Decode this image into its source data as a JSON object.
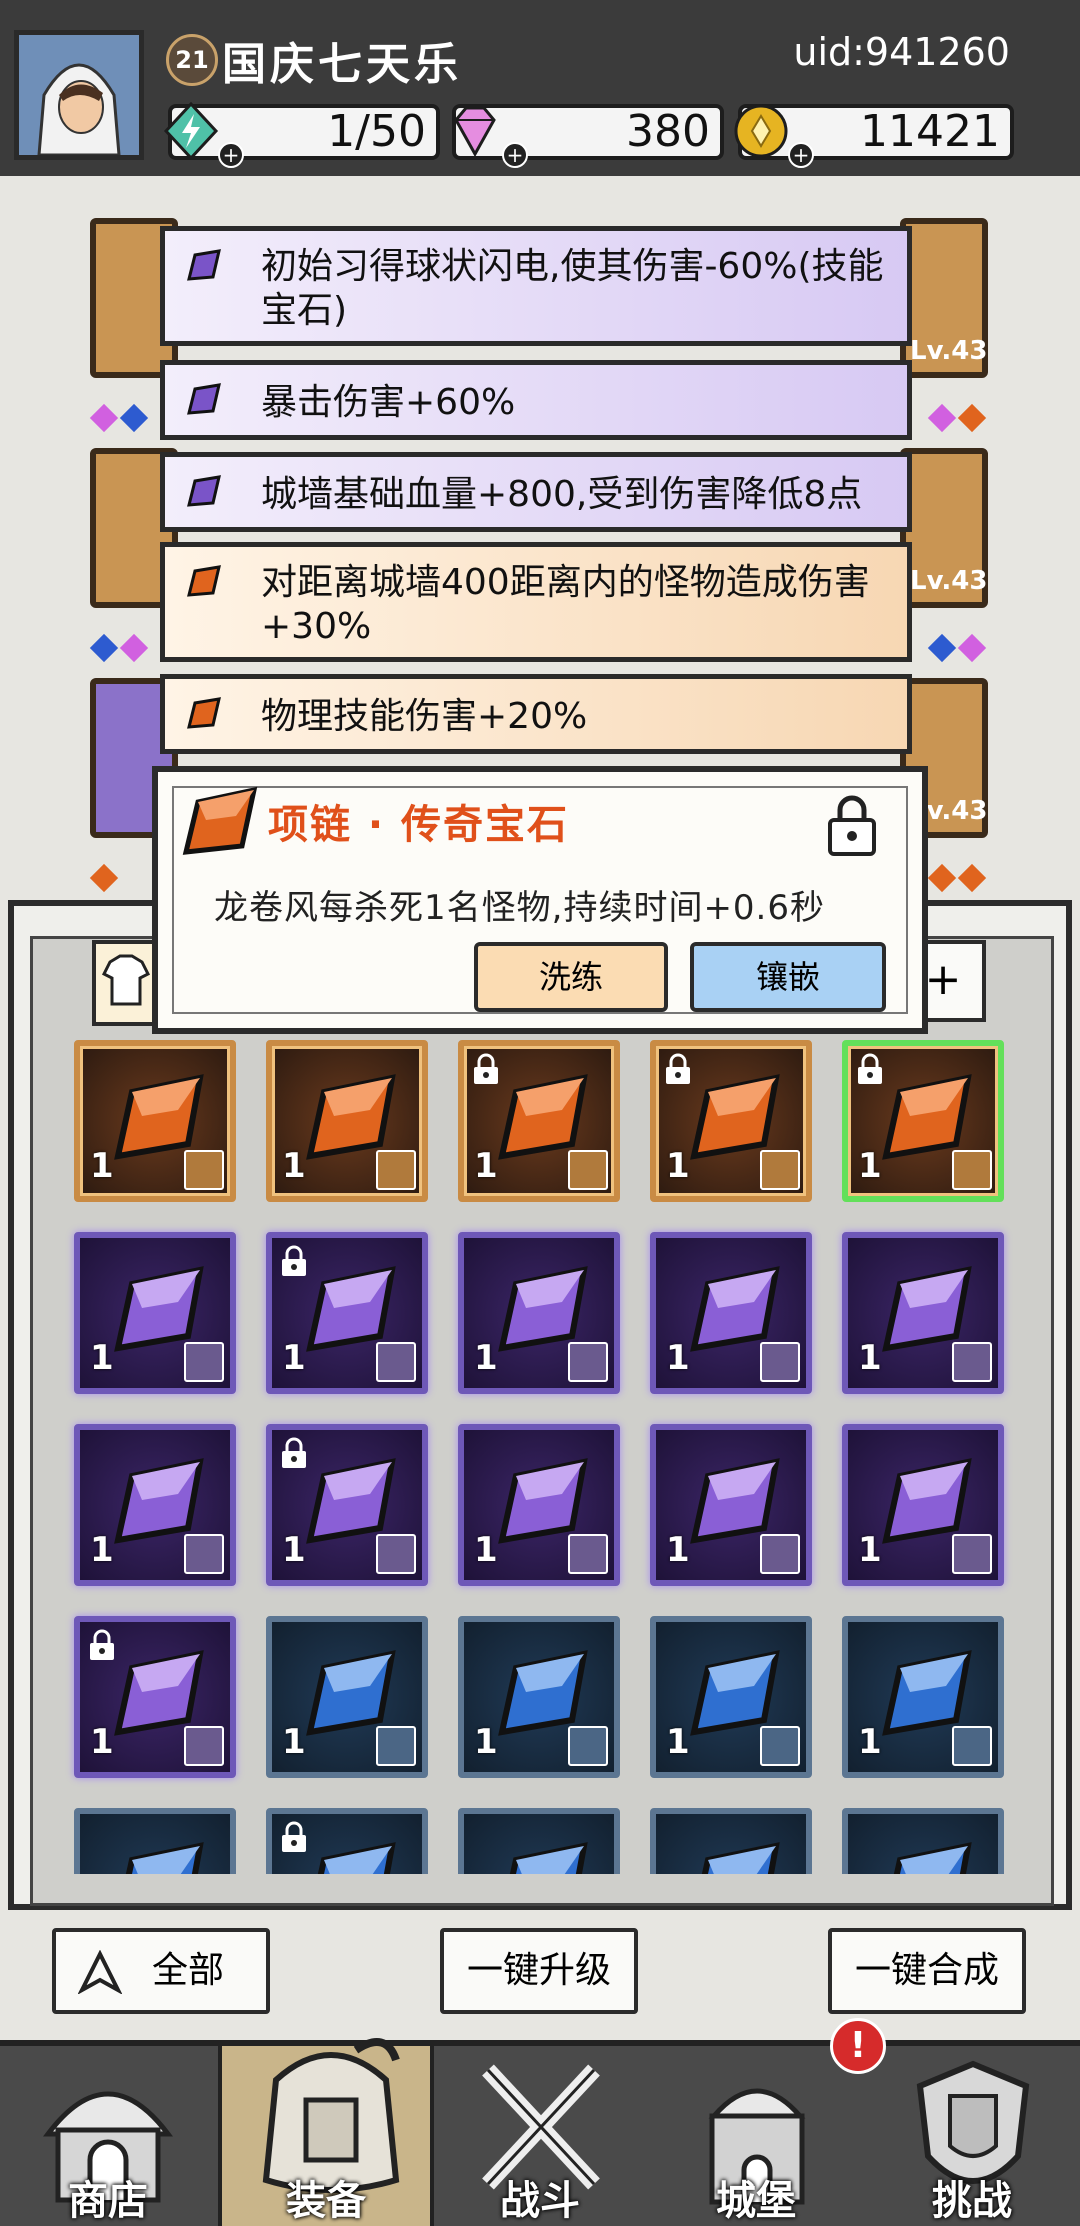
{
  "header": {
    "level": "21",
    "player_name": "国庆七天乐",
    "uid": "uid:941260",
    "energy": "1/50",
    "gems": "380",
    "gold": "11421"
  },
  "gear_levels": [
    "Lv.43",
    "Lv.43",
    "Lv.43"
  ],
  "gem_list": [
    {
      "text": "初始习得球状闪电,使其伤害-60%(技能宝石)",
      "color": "purple"
    },
    {
      "text": "暴击伤害+60%",
      "color": "purple"
    },
    {
      "text": "城墙基础血量+800,受到伤害降低8点",
      "color": "purple"
    },
    {
      "text": "对距离城墙400距离内的怪物造成伤害+30%",
      "color": "orange"
    },
    {
      "text": "物理技能伤害+20%",
      "color": "orange"
    }
  ],
  "popup": {
    "title": "项链 · 传奇宝石",
    "description": "龙卷风每杀死1名怪物,持续时间+0.6秒",
    "reroll_label": "洗练",
    "inlay_label": "镶嵌"
  },
  "inventory": {
    "rows": [
      [
        {
          "c": "orange",
          "n": "1",
          "lock": false
        },
        {
          "c": "orange",
          "n": "1",
          "lock": false
        },
        {
          "c": "orange",
          "n": "1",
          "lock": true
        },
        {
          "c": "orange",
          "n": "1",
          "lock": true
        },
        {
          "c": "orange",
          "n": "1",
          "lock": true,
          "sel": true
        }
      ],
      [
        {
          "c": "purple",
          "n": "1",
          "lock": false
        },
        {
          "c": "purple",
          "n": "1",
          "lock": true
        },
        {
          "c": "purple",
          "n": "1",
          "lock": false
        },
        {
          "c": "purple",
          "n": "1",
          "lock": false
        },
        {
          "c": "purple",
          "n": "1",
          "lock": false
        }
      ],
      [
        {
          "c": "purple",
          "n": "1",
          "lock": false
        },
        {
          "c": "purple",
          "n": "1",
          "lock": true
        },
        {
          "c": "purple",
          "n": "1",
          "lock": false
        },
        {
          "c": "purple",
          "n": "1",
          "lock": false
        },
        {
          "c": "purple",
          "n": "1",
          "lock": false
        }
      ],
      [
        {
          "c": "purple",
          "n": "1",
          "lock": true
        },
        {
          "c": "blue",
          "n": "1",
          "lock": false
        },
        {
          "c": "blue",
          "n": "1",
          "lock": false
        },
        {
          "c": "blue",
          "n": "1",
          "lock": false
        },
        {
          "c": "blue",
          "n": "1",
          "lock": false
        }
      ],
      [
        {
          "c": "blue",
          "n": "",
          "lock": false
        },
        {
          "c": "blue",
          "n": "",
          "lock": true
        },
        {
          "c": "blue",
          "n": "",
          "lock": false
        },
        {
          "c": "blue",
          "n": "",
          "lock": false
        },
        {
          "c": "blue",
          "n": "",
          "lock": false
        }
      ]
    ]
  },
  "buttons": {
    "filter_all": "全部",
    "upgrade_all": "一键升级",
    "merge_all": "一键合成"
  },
  "nav": [
    "商店",
    "装备",
    "战斗",
    "城堡",
    "挑战"
  ],
  "nav_active": 1,
  "nav_alert_badge": "!"
}
